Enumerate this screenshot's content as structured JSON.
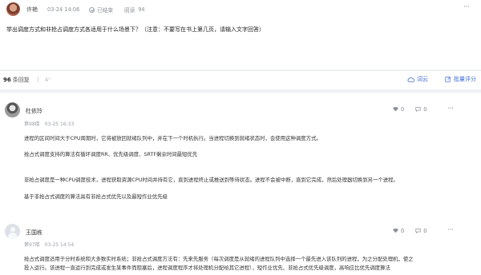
{
  "topic": {
    "author": "许艳",
    "time": "03-24 14:06",
    "status": "已结束",
    "views_label": "阅读",
    "views": "94",
    "more": "···",
    "question": "举出调度方式和非抢占调度方式各适用于什么场景下？（注意：不要写在书上第几页，请输入文字回答）"
  },
  "toolbar": {
    "reply_count": "96",
    "replies_label": "条回复",
    "reply_button": "4⁰",
    "wordcloud_label": "词云",
    "batch_label": "批量评分",
    "accent_color": "#3f6cd6"
  },
  "replies": [
    {
      "name": "杜依玲",
      "floor": "第98楼",
      "time": "03-25 16:33",
      "likes": "0",
      "comments": "0",
      "more": "···",
      "paragraphs": [
        "进程的区间时间大于CPU周期时，它将被放回就绪队列中，并在下一个时机执行。当进程切换到就绪状态时，会使用这种调度方式。",
        "抢占式调度支持的算法有循环调度RR、优先级调度、SRTF剩余时间最短优先",
        "非抢占调度是一种CPU调度技术，进程获取资源CPU时间并持有它，直到进程终止或推送到等待状态。进程不会被中断，直到它完成，然后处理器切换到另一个进程。",
        "基于非抢占式调度的算法具有非抢占式优先以及最短作业优先级"
      ]
    },
    {
      "name": "王国栋",
      "floor": "第97楼",
      "time": "03-25 14:54",
      "likes": "0",
      "comments": "0",
      "more": "···",
      "paragraphs": [
        "抢占式调度适用于分时系统和大多数实时系统；非抢占式调度方法有：先来先服务（每次调度是从就绪的进程队列中选择一个最先进入该队列的进程，为之分配处理机，使之",
        "投入运行。该进程一直运行到完成或发生某事件而阻塞后，进程调度程序才将处理机分配给其它进程），短作业优先、非抢占式优先级调度，高响应比优先调度算法"
      ]
    }
  ]
}
